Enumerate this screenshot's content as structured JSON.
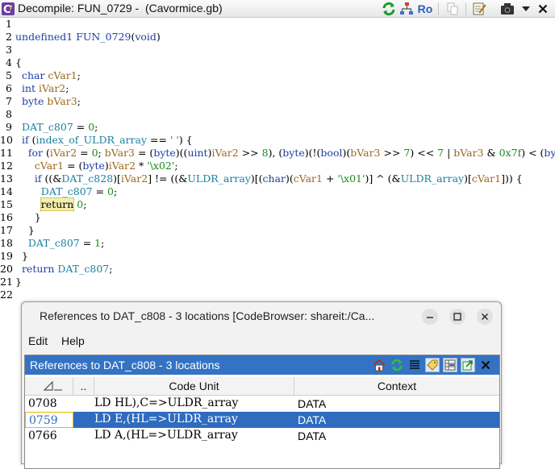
{
  "decompile": {
    "title": "Decompile: FUN_0729 -  (Cavormice.gb)",
    "ro_label": "Ro",
    "lines": [
      {
        "n": "1",
        "t": []
      },
      {
        "n": "2",
        "t": [
          [
            "k",
            "undefined1 "
          ],
          [
            "f",
            "FUN_0729"
          ],
          [
            "p",
            "("
          ],
          [
            "k",
            "void"
          ],
          [
            "p",
            ")"
          ]
        ]
      },
      {
        "n": "3",
        "t": []
      },
      {
        "n": "4",
        "t": [
          [
            "p",
            "{"
          ]
        ]
      },
      {
        "n": "5",
        "t": [
          [
            "p",
            "  "
          ],
          [
            "k",
            "char "
          ],
          [
            "v",
            "cVar1"
          ],
          [
            "p",
            ";"
          ]
        ]
      },
      {
        "n": "6",
        "t": [
          [
            "p",
            "  "
          ],
          [
            "k",
            "int "
          ],
          [
            "v",
            "iVar2"
          ],
          [
            "p",
            ";"
          ]
        ]
      },
      {
        "n": "7",
        "t": [
          [
            "p",
            "  "
          ],
          [
            "k",
            "byte "
          ],
          [
            "v",
            "bVar3"
          ],
          [
            "p",
            ";"
          ]
        ]
      },
      {
        "n": "8",
        "t": []
      },
      {
        "n": "9",
        "t": [
          [
            "p",
            "  "
          ],
          [
            "g",
            "DAT_c807"
          ],
          [
            "p",
            " = "
          ],
          [
            "s",
            "0"
          ],
          [
            "p",
            ";"
          ]
        ]
      },
      {
        "n": "10",
        "t": [
          [
            "p",
            "  "
          ],
          [
            "k",
            "if "
          ],
          [
            "p",
            "("
          ],
          [
            "g",
            "index_of_ULDR_array"
          ],
          [
            "p",
            " == "
          ],
          [
            "s",
            "' '"
          ],
          [
            "p",
            ") {"
          ]
        ]
      },
      {
        "n": "11",
        "t": [
          [
            "p",
            "    "
          ],
          [
            "k",
            "for "
          ],
          [
            "p",
            "("
          ],
          [
            "v",
            "iVar2"
          ],
          [
            "p",
            " = "
          ],
          [
            "s",
            "0"
          ],
          [
            "p",
            "; "
          ],
          [
            "v",
            "bVar3"
          ],
          [
            "p",
            " = ("
          ],
          [
            "k",
            "byte"
          ],
          [
            "p",
            ")(("
          ],
          [
            "k",
            "uint"
          ],
          [
            "p",
            ")"
          ],
          [
            "v",
            "iVar2"
          ],
          [
            "p",
            " >> "
          ],
          [
            "s",
            "8"
          ],
          [
            "p",
            "), ("
          ],
          [
            "k",
            "byte"
          ],
          [
            "p",
            ")(!("
          ],
          [
            "k",
            "bool"
          ],
          [
            "p",
            ")("
          ],
          [
            "v",
            "bVar3"
          ],
          [
            "p",
            " >> "
          ],
          [
            "s",
            "7"
          ],
          [
            "p",
            ") << "
          ],
          [
            "s",
            "7"
          ],
          [
            "p",
            " | "
          ],
          [
            "v",
            "bVar3"
          ],
          [
            "p",
            " & "
          ],
          [
            "s",
            "0x7f"
          ],
          [
            "p",
            ") < ("
          ],
          [
            "k",
            "byte"
          ],
          [
            "p",
            ")"
          ]
        ]
      },
      {
        "n": "12",
        "t": [
          [
            "p",
            "      "
          ],
          [
            "v",
            "cVar1"
          ],
          [
            "p",
            " = ("
          ],
          [
            "k",
            "byte"
          ],
          [
            "p",
            ")"
          ],
          [
            "v",
            "iVar2"
          ],
          [
            "p",
            " * "
          ],
          [
            "s",
            "'\\x02'"
          ],
          [
            "p",
            ";"
          ]
        ]
      },
      {
        "n": "13",
        "t": [
          [
            "p",
            "      "
          ],
          [
            "k",
            "if "
          ],
          [
            "p",
            "((&"
          ],
          [
            "g",
            "DAT_c828"
          ],
          [
            "p",
            ")["
          ],
          [
            "v",
            "iVar2"
          ],
          [
            "p",
            "] != ((&"
          ],
          [
            "g",
            "ULDR_array"
          ],
          [
            "p",
            ")[("
          ],
          [
            "k",
            "char"
          ],
          [
            "p",
            ")("
          ],
          [
            "v",
            "cVar1"
          ],
          [
            "p",
            " + "
          ],
          [
            "s",
            "'\\x01'"
          ],
          [
            "p",
            ")] ^ (&"
          ],
          [
            "g",
            "ULDR_array"
          ],
          [
            "p",
            ")["
          ],
          [
            "v",
            "cVar1"
          ],
          [
            "p",
            "])) {"
          ]
        ]
      },
      {
        "n": "14",
        "t": [
          [
            "p",
            "        "
          ],
          [
            "g",
            "DAT_c807"
          ],
          [
            "p",
            " = "
          ],
          [
            "s",
            "0"
          ],
          [
            "p",
            ";"
          ]
        ]
      },
      {
        "n": "15",
        "t": [
          [
            "p",
            "        "
          ],
          [
            "hl",
            "return"
          ],
          [
            "p",
            " "
          ],
          [
            "s",
            "0"
          ],
          [
            "p",
            ";"
          ]
        ]
      },
      {
        "n": "16",
        "t": [
          [
            "p",
            "      }"
          ]
        ]
      },
      {
        "n": "17",
        "t": [
          [
            "p",
            "    }"
          ]
        ]
      },
      {
        "n": "18",
        "t": [
          [
            "p",
            "    "
          ],
          [
            "g",
            "DAT_c807"
          ],
          [
            "p",
            " = "
          ],
          [
            "s",
            "1"
          ],
          [
            "p",
            ";"
          ]
        ]
      },
      {
        "n": "19",
        "t": [
          [
            "p",
            "  }"
          ]
        ]
      },
      {
        "n": "20",
        "t": [
          [
            "p",
            "  "
          ],
          [
            "k",
            "return "
          ],
          [
            "g",
            "DAT_c807"
          ],
          [
            "p",
            ";"
          ]
        ]
      },
      {
        "n": "21",
        "t": [
          [
            "p",
            "}"
          ]
        ]
      },
      {
        "n": "22",
        "t": []
      }
    ]
  },
  "dialog": {
    "title": "References to DAT_c808 - 3 locations [CodeBrowser: shareit:/Ca...",
    "menu": {
      "edit": "Edit",
      "help": "Help"
    },
    "panel_title": "References to DAT_c808 - 3 locations",
    "columns": {
      "c1": "..",
      "c2": "Code Unit",
      "c3": "Context"
    },
    "rows": [
      {
        "addr": "0708",
        "code": "LD HL),C=>ULDR_array",
        "context": "DATA",
        "selected": false
      },
      {
        "addr": "0759",
        "code": "LD E,(HL=>ULDR_array",
        "context": "DATA",
        "selected": true
      },
      {
        "addr": "0766",
        "code": "LD A,(HL=>ULDR_array",
        "context": "DATA",
        "selected": false
      }
    ]
  },
  "colors": {
    "panel_title_bg": "#3473c4",
    "selected_row": "#2f6bbf"
  }
}
